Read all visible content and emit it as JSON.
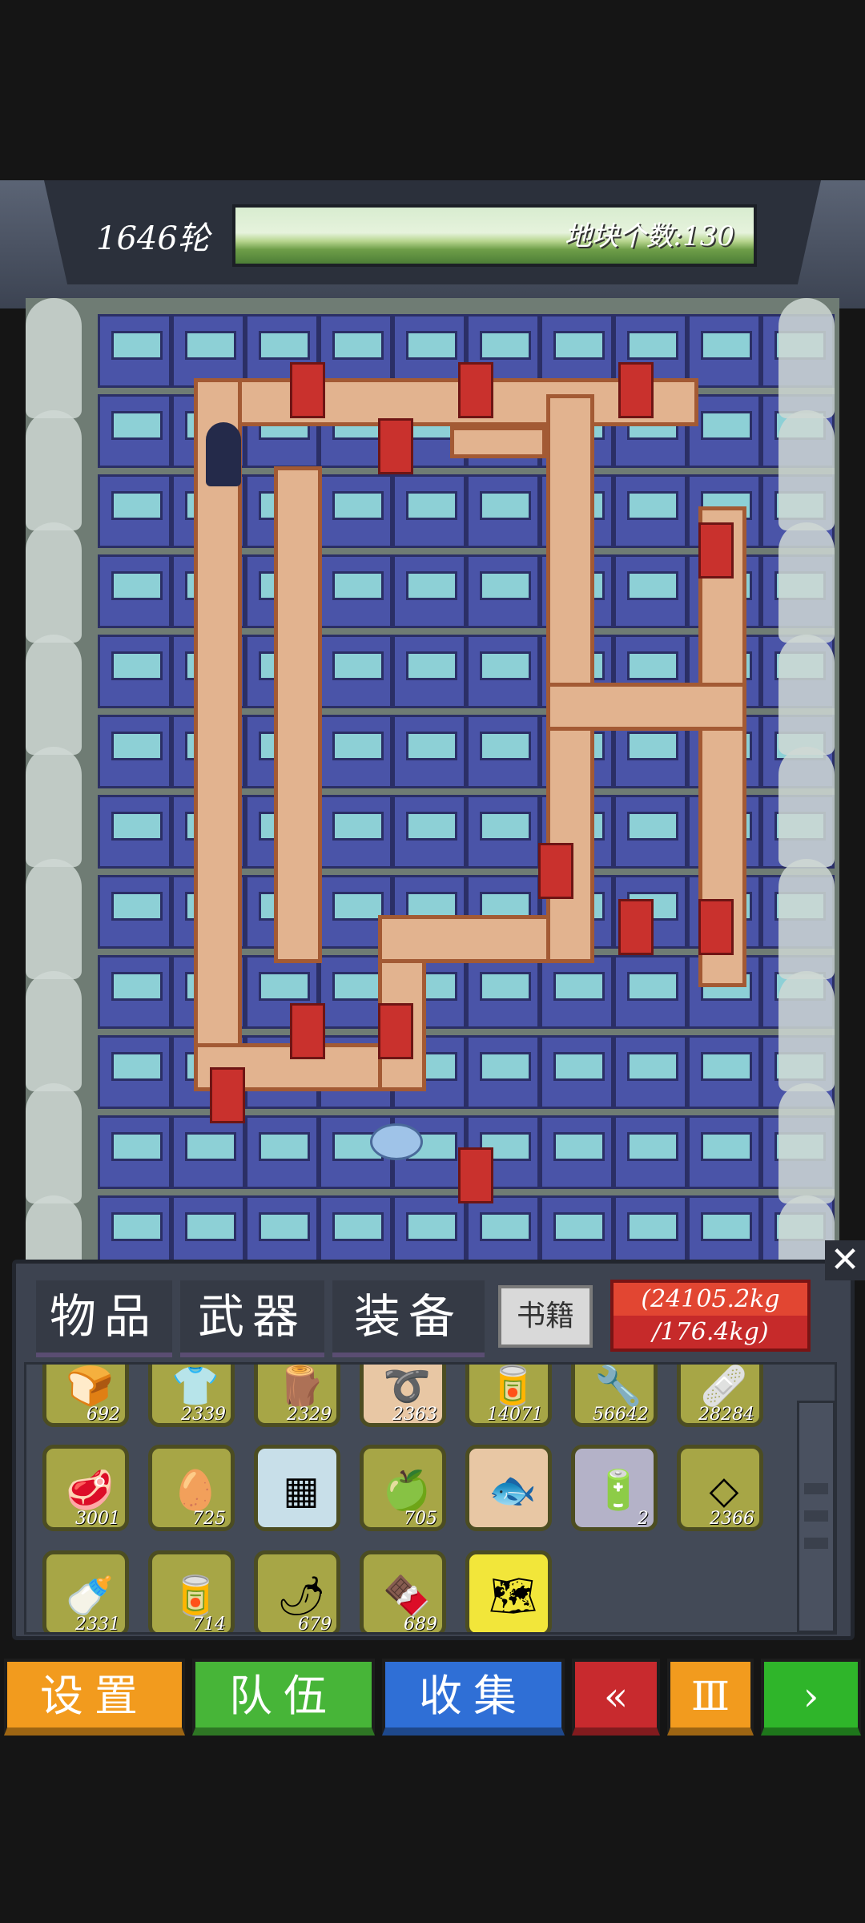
{
  "header": {
    "round_label": "1646轮",
    "tile_count_label": "地块个数:130"
  },
  "inventory": {
    "tabs": [
      "物品",
      "武器",
      "装备"
    ],
    "books_tab": "书籍",
    "weight_current": "(24105.2kg",
    "weight_max": "/176.4kg)",
    "close_icon": "close-icon",
    "rows": [
      [
        {
          "icon": "bread-icon",
          "glyph": "🍞",
          "qty": "692",
          "color": "#a7a646"
        },
        {
          "icon": "cloth-icon",
          "glyph": "👕",
          "qty": "2339",
          "color": "#a7a646"
        },
        {
          "icon": "wood-log-icon",
          "glyph": "🪵",
          "qty": "2329",
          "color": "#a7a646"
        },
        {
          "icon": "rope-icon",
          "glyph": "➰",
          "qty": "2363",
          "color": "#e8c7a4"
        },
        {
          "icon": "cans-icon",
          "glyph": "🥫",
          "qty": "14071",
          "color": "#a7a646"
        },
        {
          "icon": "pipe-icon",
          "glyph": "🔧",
          "qty": "56642",
          "color": "#a7a646"
        },
        {
          "icon": "medkit-icon",
          "glyph": "🩹",
          "qty": "28284",
          "color": "#a7a646"
        }
      ],
      [
        {
          "icon": "meat-icon",
          "glyph": "🥩",
          "qty": "3001",
          "color": "#a7a646"
        },
        {
          "icon": "egg-icon",
          "glyph": "🥚",
          "qty": "725",
          "color": "#a7a646"
        },
        {
          "icon": "circuit-board-icon",
          "glyph": "▦",
          "qty": "",
          "color": "#c8dfe9"
        },
        {
          "icon": "apple-icon",
          "glyph": "🍏",
          "qty": "705",
          "color": "#a7a646"
        },
        {
          "icon": "fish-icon",
          "glyph": "🐟",
          "qty": "",
          "color": "#e8c7a4"
        },
        {
          "icon": "battery-icon",
          "glyph": "🔋",
          "qty": "2",
          "color": "#b4b2c8"
        },
        {
          "icon": "cloth-sheet-icon",
          "glyph": "◇",
          "qty": "2366",
          "color": "#a7a646"
        }
      ],
      [
        {
          "icon": "bottle-icon",
          "glyph": "🍼",
          "qty": "2331",
          "color": "#a7a646"
        },
        {
          "icon": "can-icon",
          "glyph": "🥫",
          "qty": "714",
          "color": "#a7a646"
        },
        {
          "icon": "chili-icon",
          "glyph": "🌶",
          "qty": "679",
          "color": "#a7a646"
        },
        {
          "icon": "chocolate-icon",
          "glyph": "🍫",
          "qty": "689",
          "color": "#a7a646"
        },
        {
          "icon": "map-scroll-icon",
          "glyph": "🗺",
          "qty": "",
          "color": "#f2e63a"
        }
      ]
    ]
  },
  "bottom_bar": [
    {
      "name": "settings-button",
      "label": "设置",
      "color": "#f29b1e"
    },
    {
      "name": "team-button",
      "label": "队伍",
      "color": "#47b538"
    },
    {
      "name": "collect-button",
      "label": "收集",
      "color": "#2f6fd6"
    },
    {
      "name": "rewind-button",
      "label": "«",
      "color": "#c82a2e"
    },
    {
      "name": "pause-button",
      "label": "Ⅲ",
      "color": "#f29b1e"
    },
    {
      "name": "play-button",
      "label": "›",
      "color": "#2fb52a"
    }
  ]
}
